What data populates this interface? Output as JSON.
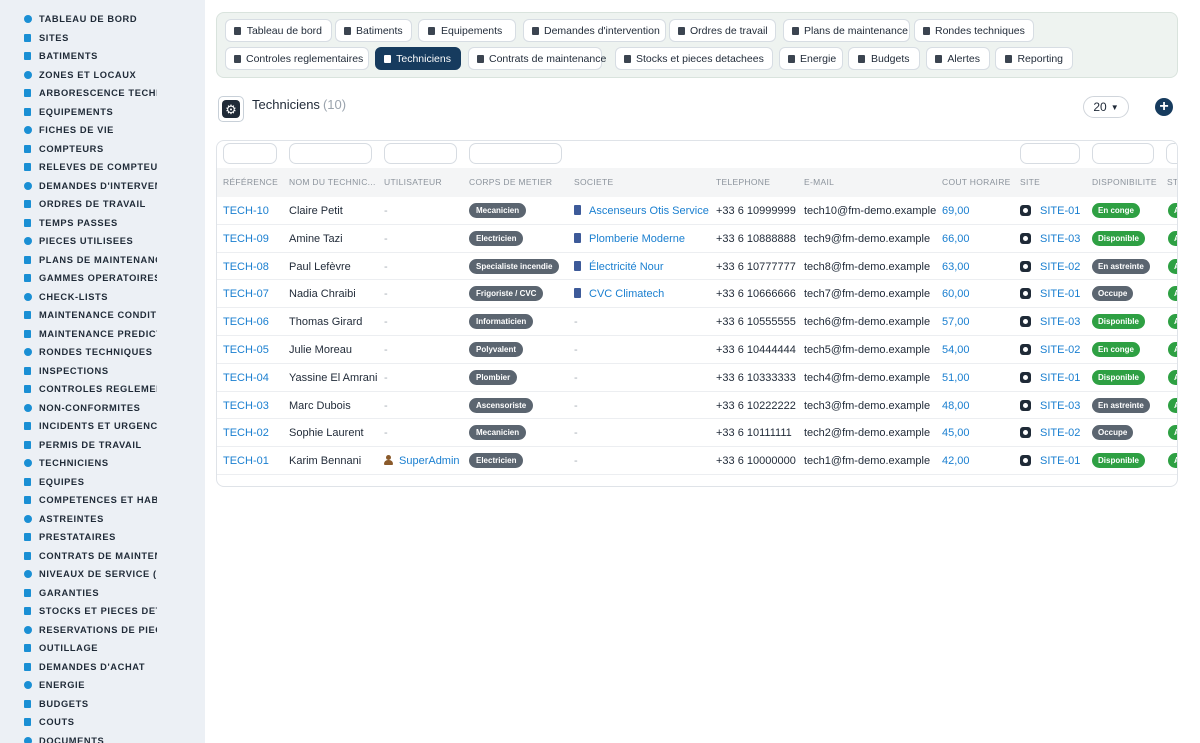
{
  "sidebar": {
    "items": [
      {
        "label": "TABLEAU DE BORD",
        "icon": "dashboard-icon"
      },
      {
        "label": "SITES",
        "icon": "location-pin-icon"
      },
      {
        "label": "BATIMENTS",
        "icon": "building-icon"
      },
      {
        "label": "ZONES ET LOCAUX",
        "icon": "grid-icon"
      },
      {
        "label": "ARBORESCENCE TECHNI",
        "icon": "tree-icon"
      },
      {
        "label": "EQUIPEMENTS",
        "icon": "cogs-icon"
      },
      {
        "label": "FICHES DE VIE",
        "icon": "history-icon"
      },
      {
        "label": "COMPTEURS",
        "icon": "gauge-icon"
      },
      {
        "label": "RELEVES DE COMPTEURS",
        "icon": "list-icon"
      },
      {
        "label": "DEMANDES D'INTERVENT",
        "icon": "question-circle-icon"
      },
      {
        "label": "ORDRES DE TRAVAIL",
        "icon": "clipboard-icon"
      },
      {
        "label": "TEMPS PASSES",
        "icon": "clock-icon"
      },
      {
        "label": "PIECES UTILISEES",
        "icon": "boxes-icon"
      },
      {
        "label": "PLANS DE MAINTENANCE",
        "icon": "calendar-icon"
      },
      {
        "label": "GAMMES OPERATOIRES",
        "icon": "tasks-icon"
      },
      {
        "label": "CHECK-LISTS",
        "icon": "checklist-icon"
      },
      {
        "label": "MAINTENANCE CONDITIO",
        "icon": "thermometer-icon"
      },
      {
        "label": "MAINTENANCE PREDICTI",
        "icon": "chart-line-icon"
      },
      {
        "label": "RONDES TECHNIQUES",
        "icon": "route-icon"
      },
      {
        "label": "INSPECTIONS",
        "icon": "search-icon"
      },
      {
        "label": "CONTROLES REGLEMENT",
        "icon": "clipboard-check-icon"
      },
      {
        "label": "NON-CONFORMITES",
        "icon": "exclamation-circle-icon"
      },
      {
        "label": "INCIDENTS ET URGENCES",
        "icon": "warning-icon"
      },
      {
        "label": "PERMIS DE TRAVAIL",
        "icon": "file-signature-icon"
      },
      {
        "label": "TECHNICIENS",
        "icon": "hard-hat-icon"
      },
      {
        "label": "EQUIPES",
        "icon": "users-icon"
      },
      {
        "label": "COMPETENCES ET HABIL",
        "icon": "certificate-icon"
      },
      {
        "label": "ASTREINTES",
        "icon": "user-clock-icon"
      },
      {
        "label": "PRESTATAIRES",
        "icon": "handshake-icon"
      },
      {
        "label": "CONTRATS DE MAINTENA",
        "icon": "file-contract-icon"
      },
      {
        "label": "NIVEAUX DE SERVICE (SL",
        "icon": "stopwatch-icon"
      },
      {
        "label": "GARANTIES",
        "icon": "shield-icon"
      },
      {
        "label": "STOCKS ET PIECES DETA",
        "icon": "boxes-icon"
      },
      {
        "label": "RESERVATIONS DE PIECE",
        "icon": "bookmark-icon"
      },
      {
        "label": "OUTILLAGE",
        "icon": "tools-icon"
      },
      {
        "label": "DEMANDES D'ACHAT",
        "icon": "cart-icon"
      },
      {
        "label": "ENERGIE",
        "icon": "bolt-icon"
      },
      {
        "label": "BUDGETS",
        "icon": "money-icon"
      },
      {
        "label": "COUTS",
        "icon": "coins-icon"
      },
      {
        "label": "DOCUMENTS",
        "icon": "file-icon"
      }
    ]
  },
  "tabs": {
    "row1": [
      {
        "label": "Tableau de bord",
        "icon": "dashboard-icon"
      },
      {
        "label": "Batiments",
        "icon": "building-icon"
      },
      {
        "label": "Equipements",
        "icon": "cogs-icon"
      },
      {
        "label": "Demandes d'intervention",
        "icon": "question-circle-icon"
      },
      {
        "label": "Ordres de travail",
        "icon": "clipboard-icon"
      },
      {
        "label": "Plans de maintenance",
        "icon": "calendar-icon"
      },
      {
        "label": "Rondes techniques",
        "icon": "route-icon"
      }
    ],
    "row2": [
      {
        "label": "Controles reglementaires",
        "icon": "clipboard-check-icon"
      },
      {
        "label": "Techniciens",
        "icon": "hard-hat-icon",
        "active": true
      },
      {
        "label": "Contrats de maintenance",
        "icon": "file-contract-icon"
      },
      {
        "label": "Stocks et pieces detachees",
        "icon": "boxes-icon"
      },
      {
        "label": "Energie",
        "icon": "bolt-icon"
      },
      {
        "label": "Budgets",
        "icon": "money-icon"
      },
      {
        "label": "Alertes",
        "icon": "bell-icon"
      },
      {
        "label": "Reporting",
        "icon": "pie-chart-icon"
      }
    ]
  },
  "header": {
    "title": "Techniciens",
    "count": "(10)",
    "per_page": "20"
  },
  "table": {
    "columns": [
      "RÉFÉRENCE",
      "NOM DU TECHNIC...",
      "UTILISATEUR",
      "CORPS DE METIER",
      "SOCIETE",
      "TELEPHONE",
      "E-MAIL",
      "COUT HORAIRE",
      "SITE",
      "DISPONIBILITE",
      "ST"
    ],
    "rows": [
      {
        "ref": "TECH-10",
        "name": "Claire Petit",
        "user": "-",
        "metier": "Mecanicien",
        "societe": "Ascenseurs Otis Service",
        "tel": "+33 6 10999999",
        "email": "tech10@fm-demo.example",
        "cout": "69,00",
        "site": "SITE-01",
        "dispo": "En conge",
        "dispo_color": "green",
        "statut": "A"
      },
      {
        "ref": "TECH-09",
        "name": "Amine Tazi",
        "user": "-",
        "metier": "Electricien",
        "societe": "Plomberie Moderne",
        "tel": "+33 6 10888888",
        "email": "tech9@fm-demo.example",
        "cout": "66,00",
        "site": "SITE-03",
        "dispo": "Disponible",
        "dispo_color": "green",
        "statut": "A"
      },
      {
        "ref": "TECH-08",
        "name": "Paul Lefèvre",
        "user": "-",
        "metier": "Specialiste incendie",
        "societe": "Électricité Nour",
        "tel": "+33 6 10777777",
        "email": "tech8@fm-demo.example",
        "cout": "63,00",
        "site": "SITE-02",
        "dispo": "En astreinte",
        "dispo_color": "gray",
        "statut": "A"
      },
      {
        "ref": "TECH-07",
        "name": "Nadia Chraibi",
        "user": "-",
        "metier": "Frigoriste / CVC",
        "societe": "CVC Climatech",
        "tel": "+33 6 10666666",
        "email": "tech7@fm-demo.example",
        "cout": "60,00",
        "site": "SITE-01",
        "dispo": "Occupe",
        "dispo_color": "gray",
        "statut": "A"
      },
      {
        "ref": "TECH-06",
        "name": "Thomas Girard",
        "user": "-",
        "metier": "Informaticien",
        "societe": "-",
        "tel": "+33 6 10555555",
        "email": "tech6@fm-demo.example",
        "cout": "57,00",
        "site": "SITE-03",
        "dispo": "Disponible",
        "dispo_color": "green",
        "statut": "A"
      },
      {
        "ref": "TECH-05",
        "name": "Julie Moreau",
        "user": "-",
        "metier": "Polyvalent",
        "societe": "-",
        "tel": "+33 6 10444444",
        "email": "tech5@fm-demo.example",
        "cout": "54,00",
        "site": "SITE-02",
        "dispo": "En conge",
        "dispo_color": "green",
        "statut": "A"
      },
      {
        "ref": "TECH-04",
        "name": "Yassine El Amrani",
        "user": "-",
        "metier": "Plombier",
        "societe": "-",
        "tel": "+33 6 10333333",
        "email": "tech4@fm-demo.example",
        "cout": "51,00",
        "site": "SITE-01",
        "dispo": "Disponible",
        "dispo_color": "green",
        "statut": "A"
      },
      {
        "ref": "TECH-03",
        "name": "Marc Dubois",
        "user": "-",
        "metier": "Ascensoriste",
        "societe": "-",
        "tel": "+33 6 10222222",
        "email": "tech3@fm-demo.example",
        "cout": "48,00",
        "site": "SITE-03",
        "dispo": "En astreinte",
        "dispo_color": "gray",
        "statut": "A"
      },
      {
        "ref": "TECH-02",
        "name": "Sophie Laurent",
        "user": "-",
        "metier": "Mecanicien",
        "societe": "-",
        "tel": "+33 6 10111111",
        "email": "tech2@fm-demo.example",
        "cout": "45,00",
        "site": "SITE-02",
        "dispo": "Occupe",
        "dispo_color": "gray",
        "statut": "A"
      },
      {
        "ref": "TECH-01",
        "name": "Karim Bennani",
        "user": "SuperAdmin",
        "metier": "Electricien",
        "societe": "-",
        "tel": "+33 6 10000000",
        "email": "tech1@fm-demo.example",
        "cout": "42,00",
        "site": "SITE-01",
        "dispo": "Disponible",
        "dispo_color": "green",
        "statut": "A"
      }
    ]
  },
  "colors": {
    "accent": "#163b5e",
    "link": "#1a7fd0",
    "sidebar_bg": "#ecf0f5",
    "status_green": "#2ea043",
    "status_gray": "#5b6570"
  }
}
